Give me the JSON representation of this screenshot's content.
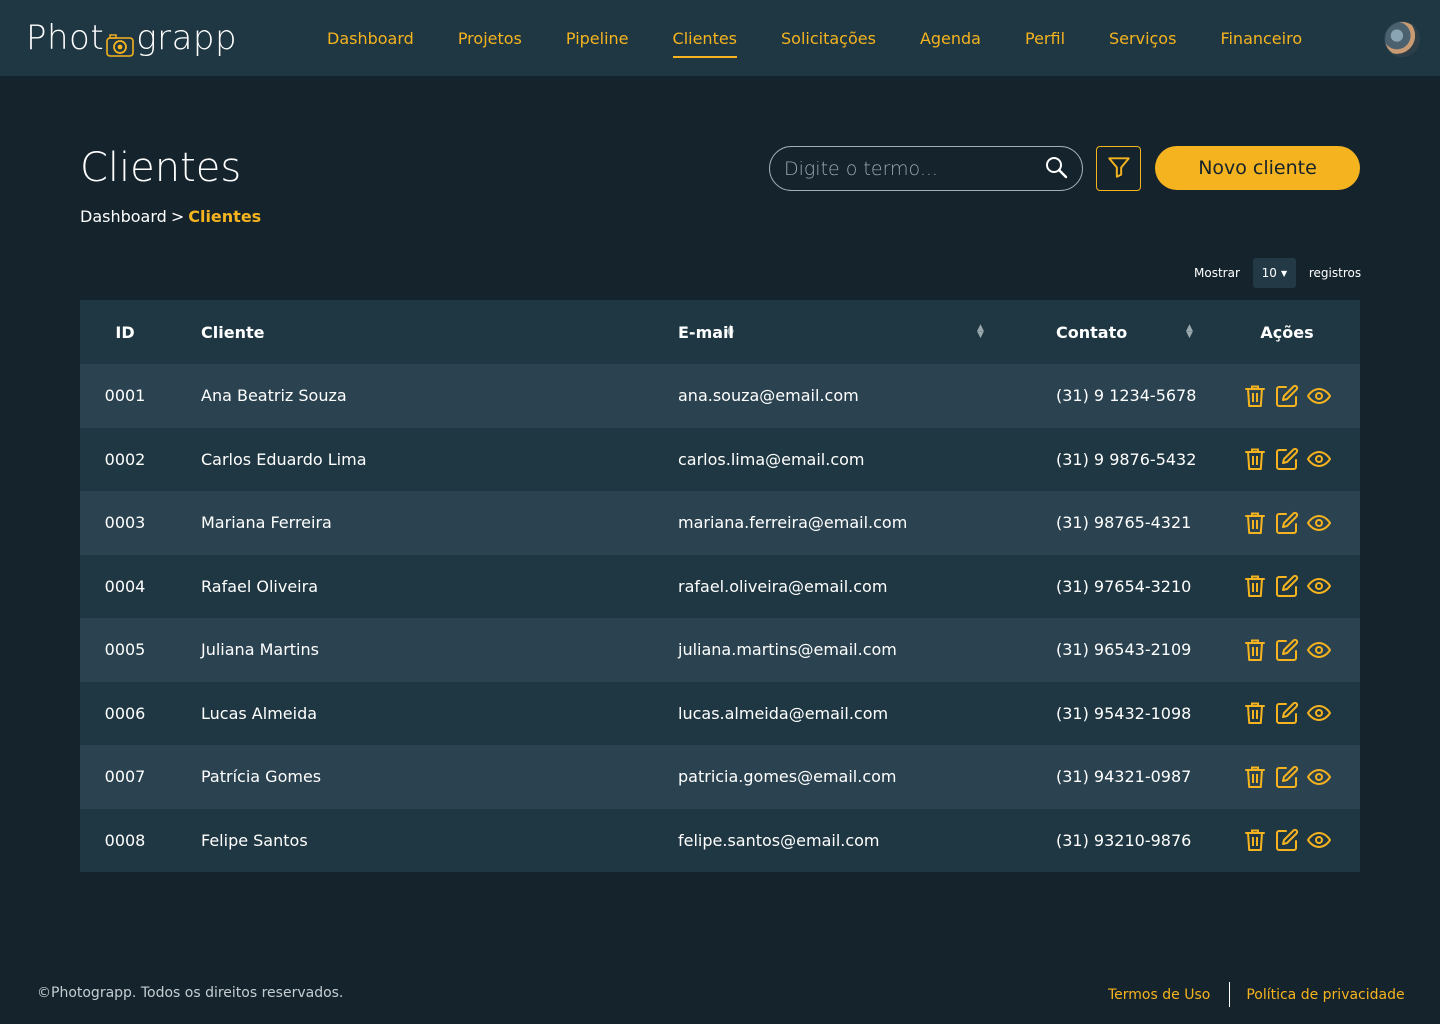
{
  "app": {
    "logo_left": "Phot",
    "logo_right": "grapp"
  },
  "nav": [
    {
      "label": "Dashboard",
      "active": false
    },
    {
      "label": "Projetos",
      "active": false
    },
    {
      "label": "Pipeline",
      "active": false
    },
    {
      "label": "Clientes",
      "active": true
    },
    {
      "label": "Solicitações",
      "active": false
    },
    {
      "label": "Agenda",
      "active": false
    },
    {
      "label": "Perfil",
      "active": false
    },
    {
      "label": "Serviços",
      "active": false
    },
    {
      "label": "Financeiro",
      "active": false
    }
  ],
  "header": {
    "title": "Clientes",
    "breadcrumb": {
      "parent": "Dashboard",
      "separator": ">",
      "current": "Clientes"
    }
  },
  "search": {
    "placeholder": "Digite o termo...",
    "value": ""
  },
  "toolbar": {
    "new_label": "Novo cliente"
  },
  "pagination": {
    "show_label": "Mostrar",
    "page_size": "10",
    "records_label": "registros"
  },
  "table": {
    "columns": [
      "ID",
      "Cliente",
      "E-mail",
      "Contato",
      "Ações"
    ],
    "rows": [
      {
        "id": "0001",
        "name": "Ana Beatriz Souza",
        "email": "ana.souza@email.com",
        "phone": "(31) 9 1234-5678"
      },
      {
        "id": "0002",
        "name": "Carlos Eduardo Lima",
        "email": "carlos.lima@email.com",
        "phone": "(31) 9 9876-5432"
      },
      {
        "id": "0003",
        "name": "Mariana Ferreira",
        "email": "mariana.ferreira@email.com",
        "phone": "(31) 98765-4321"
      },
      {
        "id": "0004",
        "name": "Rafael Oliveira",
        "email": "rafael.oliveira@email.com",
        "phone": "(31) 97654-3210"
      },
      {
        "id": "0005",
        "name": "Juliana Martins",
        "email": "juliana.martins@email.com",
        "phone": "(31) 96543-2109"
      },
      {
        "id": "0006",
        "name": "Lucas Almeida",
        "email": "lucas.almeida@email.com",
        "phone": "(31) 95432-1098"
      },
      {
        "id": "0007",
        "name": "Patrícia Gomes",
        "email": "patricia.gomes@email.com",
        "phone": "(31) 94321-0987"
      },
      {
        "id": "0008",
        "name": "Felipe Santos",
        "email": "felipe.santos@email.com",
        "phone": "(31) 93210-9876"
      }
    ],
    "row_actions": [
      "trash-icon",
      "edit-icon",
      "eye-icon"
    ]
  },
  "footer": {
    "copyright": "©Photograpp. Todos os direitos reservados.",
    "terms": "Termos de Uso",
    "privacy": "Política de privacidade"
  },
  "colors": {
    "background": "#14232c",
    "bar": "#1f3742",
    "accent": "#f5b31f",
    "row_alt": "#2b4350"
  }
}
